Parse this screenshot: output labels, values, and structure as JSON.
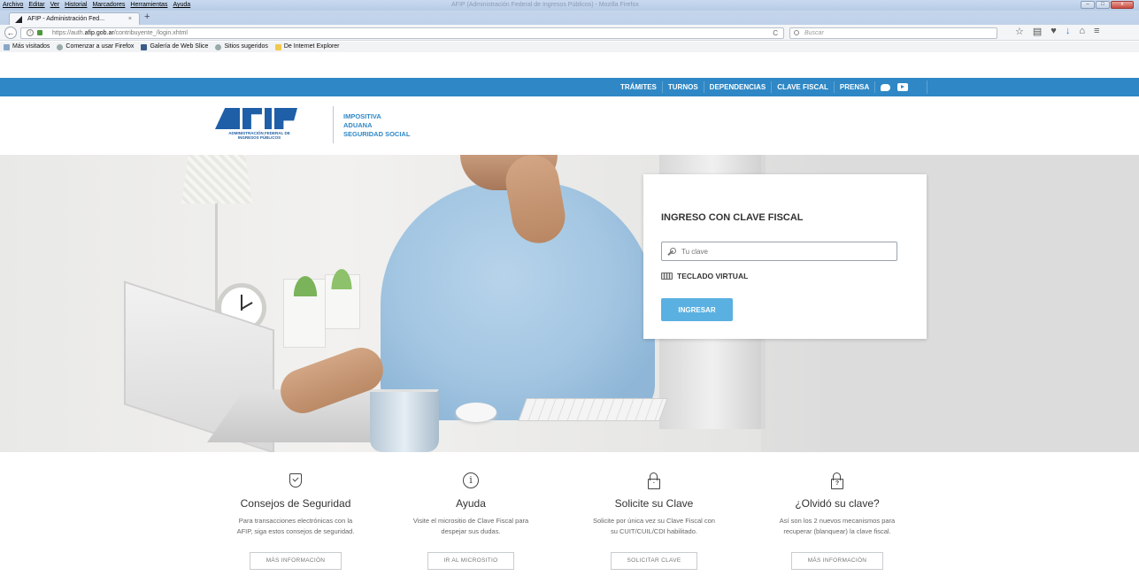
{
  "browser": {
    "menu": [
      "Archivo",
      "Editar",
      "Ver",
      "Historial",
      "Marcadores",
      "Herramientas",
      "Ayuda"
    ],
    "window_title": "AFIP (Administración Federal de Ingresos Públicos) - Mozilla Firefox",
    "tab_title": "AFIP - Administración Fed...",
    "url_prefix": "https://auth.",
    "url_host": "afip.gob.ar",
    "url_path": "/contribuyente_/login.xhtml",
    "search_placeholder": "Buscar",
    "bookmarks": [
      "Más visitados",
      "Comenzar a usar Firefox",
      "Galería de Web Slice",
      "Sitios sugeridos",
      "De Internet Explorer"
    ]
  },
  "sitenav": {
    "links": [
      "TRÁMITES",
      "TURNOS",
      "DEPENDENCIAS",
      "CLAVE FISCAL",
      "PRENSA"
    ]
  },
  "header": {
    "logo_sub_line1": "ADMINISTRACIÓN FEDERAL DE",
    "logo_sub_line2": "INGRESOS PÚBLICOS",
    "areas": [
      "IMPOSITIVA",
      "ADUANA",
      "SEGURIDAD SOCIAL"
    ]
  },
  "login": {
    "title": "INGRESO CON CLAVE FISCAL",
    "password_placeholder": "Tu clave",
    "virtual_keyboard_label": "TECLADO VIRTUAL",
    "submit_label": "INGRESAR"
  },
  "features": [
    {
      "icon": "shield-check-icon",
      "title": "Consejos de Seguridad",
      "text_line1": "Para transacciones electrónicas con la",
      "text_line2": "AFIP, siga estos consejos de seguridad.",
      "button": "MÁS INFORMACIÓN"
    },
    {
      "icon": "info-icon",
      "title": "Ayuda",
      "text_line1": "Visite el micrositio de Clave Fiscal para",
      "text_line2": "despejar sus dudas.",
      "button": "IR AL MICROSITIO"
    },
    {
      "icon": "padlock-icon",
      "title": "Solicite su Clave",
      "text_line1": "Solicite por única vez su Clave Fiscal con",
      "text_line2": "su CUIT/CUIL/CDI habilitado.",
      "button": "SOLICITAR CLAVE"
    },
    {
      "icon": "padlock-question-icon",
      "title": "¿Olvidó su clave?",
      "text_line1": "Así son los 2 nuevos mecanismos para",
      "text_line2": "recuperar (blanquear) la clave fiscal.",
      "button": "MÁS INFORMACIÓN",
      "icon_glyph": "?"
    }
  ],
  "colors": {
    "brand_blue": "#2f88c5",
    "button_blue": "#5ab0e0",
    "logo_blue": "#1f5fa8"
  }
}
